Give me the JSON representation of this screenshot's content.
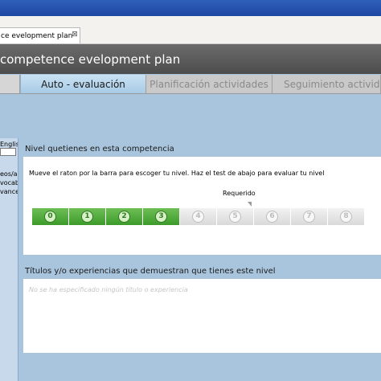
{
  "window": {
    "tab_label": "ce evelopment plan",
    "close_glyph": "⊠"
  },
  "header": {
    "title": "competence evelopment plan"
  },
  "subtabs": [
    {
      "label": "",
      "active": false
    },
    {
      "label": "Auto - evaluación",
      "active": true
    },
    {
      "label": "Planificación actividades",
      "active": false
    },
    {
      "label": "Seguimiento actividades",
      "active": false
    }
  ],
  "left_panel": {
    "language": "Englis",
    "items": [
      "eos/a",
      "vocab",
      "vance"
    ]
  },
  "level_panel": {
    "title": "Nivel quetienes en esta competencia",
    "instruction": "Mueve el raton por la barra para escoger tu nivel. Haz el test de abajo para evaluar tu nivel",
    "required_label": "Requerido",
    "current_level": 3,
    "required_level": 5,
    "levels": [
      "0",
      "1",
      "2",
      "3",
      "4",
      "5",
      "6",
      "7",
      "8"
    ],
    "colors": {
      "achieved": "#4caa36",
      "unachieved": "#e3e3e3"
    }
  },
  "titles_panel": {
    "title": "Títulos y/o experiencias que demuestran que tienes este nivel",
    "empty_text": "No se ha especificado ningún título o experiencia"
  }
}
